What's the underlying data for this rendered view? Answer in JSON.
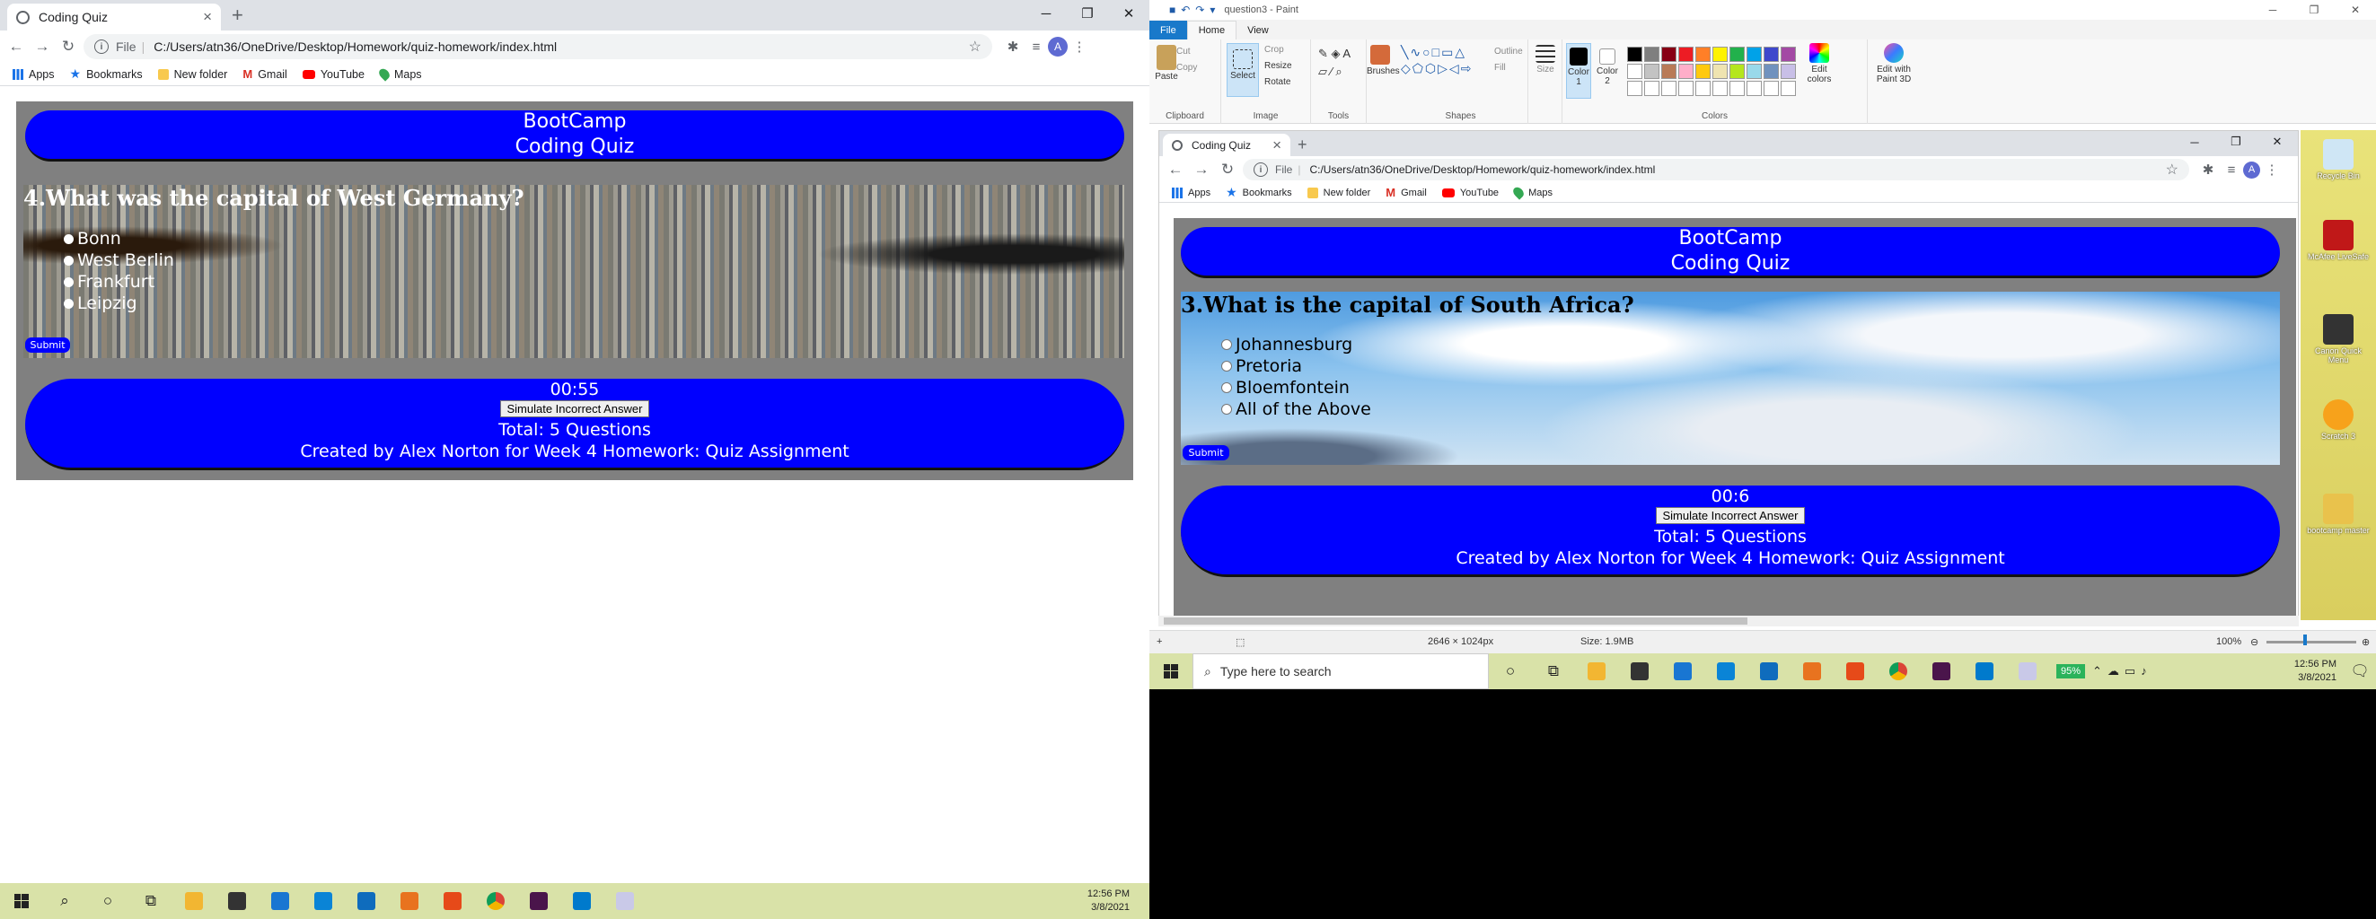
{
  "left_browser": {
    "tab_title": "Coding Quiz",
    "address_scheme": "File",
    "address_url": "C:/Users/atn36/OneDrive/Desktop/Homework/quiz-homework/index.html",
    "avatar_letter": "A",
    "bookmarks": [
      "Apps",
      "Bookmarks",
      "New folder",
      "Gmail",
      "YouTube",
      "Maps"
    ]
  },
  "left_quiz": {
    "header_line1": "BootCamp",
    "header_line2": "Coding Quiz",
    "question": "4.What was the capital of West Germany?",
    "choices": [
      "Bonn",
      "West Berlin",
      "Frankfurt",
      "Leipzig"
    ],
    "submit_label": "Submit",
    "timer": "00:55",
    "simulate_label": "Simulate Incorrect Answer",
    "total": "Total: 5 Questions",
    "credit": "Created by Alex Norton for Week 4 Homework: Quiz Assignment"
  },
  "left_taskbar": {
    "time": "12:56 PM",
    "date": "3/8/2021"
  },
  "paint": {
    "title": "question3 - Paint",
    "tabs": [
      "File",
      "Home",
      "View"
    ],
    "clipboard": {
      "paste": "Paste",
      "cut": "Cut",
      "copy": "Copy",
      "label": "Clipboard"
    },
    "image": {
      "select": "Select",
      "crop": "Crop",
      "resize": "Resize",
      "rotate": "Rotate",
      "label": "Image"
    },
    "tools_label": "Tools",
    "brushes": "Brushes",
    "shapes": {
      "outline": "Outline",
      "fill": "Fill",
      "label": "Shapes"
    },
    "size": "Size",
    "color1": "Color 1",
    "color2": "Color 2",
    "colors_label": "Colors",
    "edit_colors": "Edit colors",
    "edit_paint3d": "Edit with Paint 3D",
    "palette": [
      "#000000",
      "#7f7f7f",
      "#880015",
      "#ed1c24",
      "#ff7f27",
      "#fff200",
      "#22b14c",
      "#00a2e8",
      "#3f48cc",
      "#a349a4",
      "#ffffff",
      "#c3c3c3",
      "#b97a57",
      "#ffaec9",
      "#ffc90e",
      "#efe4b0",
      "#b5e61d",
      "#99d9ea",
      "#7092be",
      "#c8bfe7"
    ],
    "status_dims": "2646 × 1024px",
    "status_size": "Size: 1.9MB",
    "zoom": "100%"
  },
  "right_browser": {
    "tab_title": "Coding Quiz",
    "address_scheme": "File",
    "address_url": "C:/Users/atn36/OneDrive/Desktop/Homework/quiz-homework/index.html",
    "avatar_letter": "A",
    "bookmarks": [
      "Apps",
      "Bookmarks",
      "New folder",
      "Gmail",
      "YouTube",
      "Maps"
    ]
  },
  "right_quiz": {
    "header_line1": "BootCamp",
    "header_line2": "Coding Quiz",
    "question": "3.What is the capital of South Africa?",
    "choices": [
      "Johannesburg",
      "Pretoria",
      "Bloemfontein",
      "All of the Above"
    ],
    "submit_label": "Submit",
    "timer": "00:6",
    "simulate_label": "Simulate Incorrect Answer",
    "total": "Total: 5 Questions",
    "credit": "Created by Alex Norton for Week 4 Homework: Quiz Assignment"
  },
  "desktop_icons": [
    "Recycle Bin",
    "McAfee LiveSafe",
    "Canon Quick Menu",
    "Scratch 3",
    "bootcamp master"
  ],
  "right_taskbar": {
    "search_placeholder": "Type here to search",
    "battery": "95%",
    "time": "12:56 PM",
    "date": "3/8/2021"
  }
}
